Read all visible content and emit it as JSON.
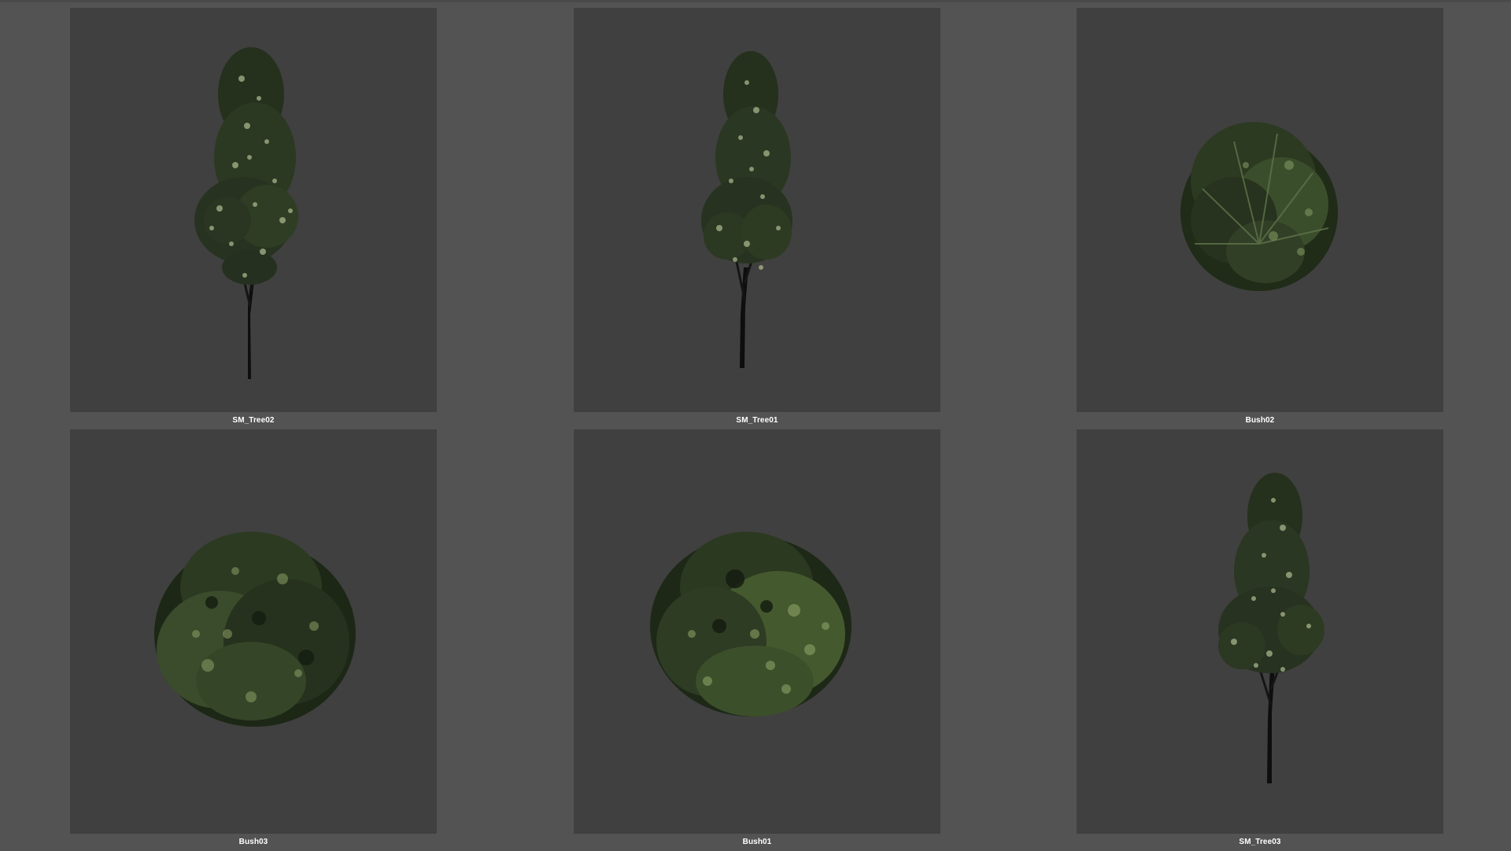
{
  "browser": {
    "assets": [
      {
        "name": "SM_Tree02",
        "kind": "tree"
      },
      {
        "name": "SM_Tree01",
        "kind": "tree"
      },
      {
        "name": "Bush02",
        "kind": "bush"
      },
      {
        "name": "Bush03",
        "kind": "bush"
      },
      {
        "name": "Bush01",
        "kind": "bush"
      },
      {
        "name": "SM_Tree03",
        "kind": "tree"
      }
    ]
  },
  "colors": {
    "background": "#535353",
    "thumbnail": "#404040",
    "label": "#ffffff",
    "foliage_dark": "#1f2a18",
    "foliage_mid": "#3f5330",
    "foliage_light": "#8fa070",
    "trunk": "#111111"
  }
}
